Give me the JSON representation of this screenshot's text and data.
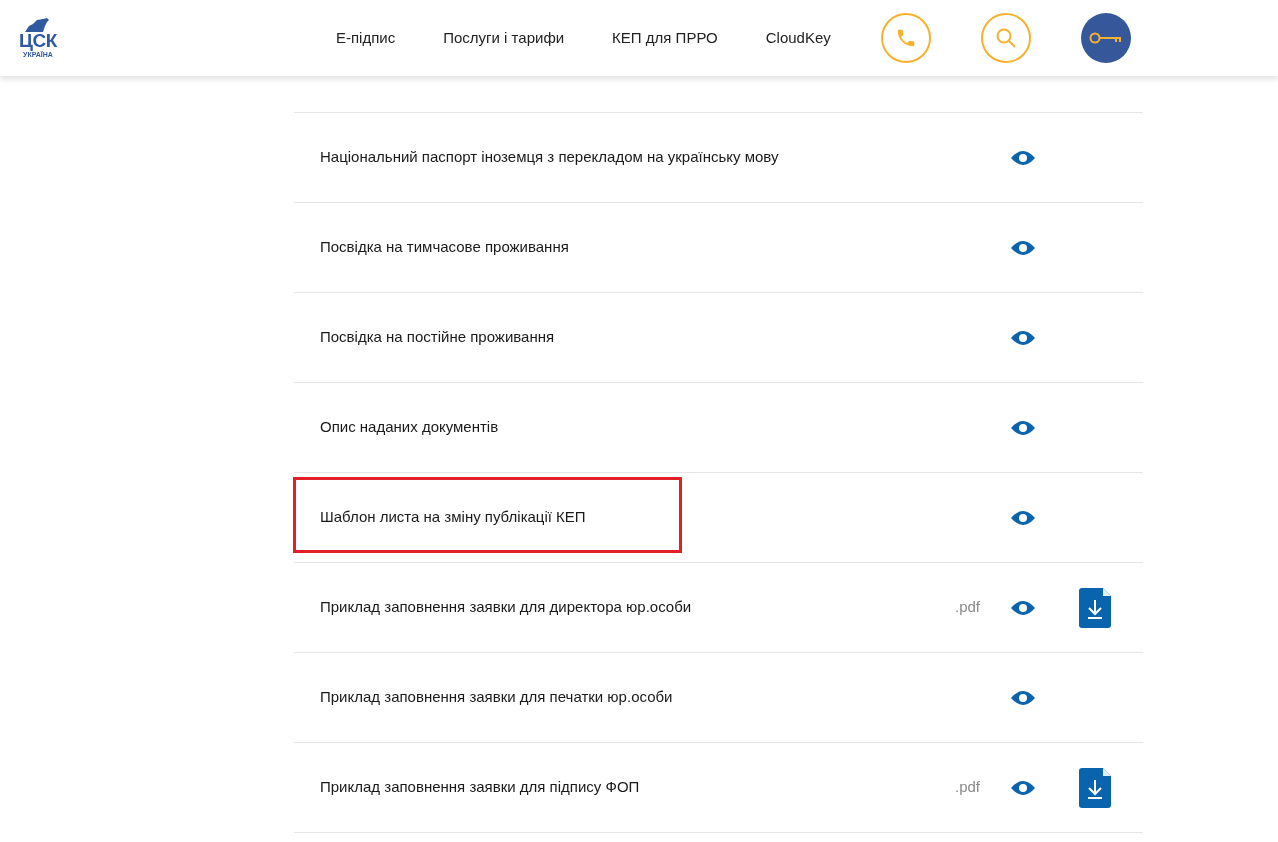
{
  "logo": {
    "title": "ЦСК",
    "subtitle": "УКРАЇНА"
  },
  "nav": [
    "Е-підпис",
    "Послуги і тарифи",
    "КЕП для ПРРО",
    "CloudKey"
  ],
  "documents": [
    {
      "title": "Національний паспорт іноземця з перекладом на українську мову",
      "highlighted": false,
      "download": false
    },
    {
      "title": "Посвідка на тимчасове проживання",
      "highlighted": false,
      "download": false
    },
    {
      "title": "Посвідка на постійне проживання",
      "highlighted": false,
      "download": false
    },
    {
      "title": "Опис наданих документів",
      "highlighted": false,
      "download": false
    },
    {
      "title": "Шаблон листа на зміну публікації КЕП",
      "highlighted": true,
      "download": false
    },
    {
      "title": "Приклад заповнення заявки для директора юр.особи",
      "format": ".pdf",
      "highlighted": false,
      "download": true
    },
    {
      "title": "Приклад заповнення заявки для печатки юр.особи",
      "highlighted": false,
      "download": false
    },
    {
      "title": "Приклад заповнення заявки для підпису ФОП",
      "format": ".pdf",
      "highlighted": false,
      "download": true
    }
  ]
}
